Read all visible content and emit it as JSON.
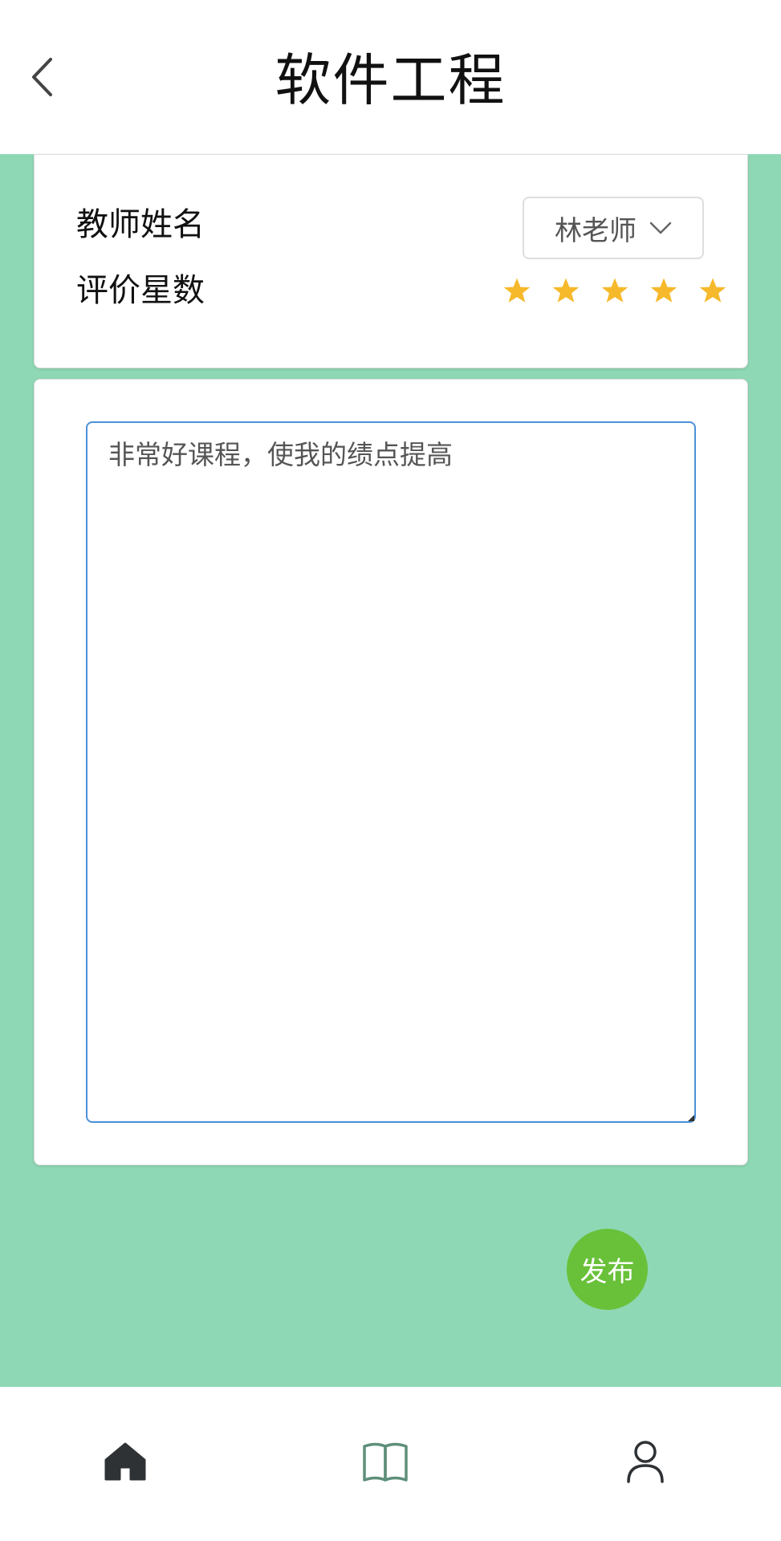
{
  "header": {
    "title": "软件工程",
    "back_icon": "chevron-left-icon"
  },
  "info_card": {
    "teacher_label": "教师姓名",
    "teacher_selected": "林老师",
    "rating_label": "评价星数",
    "rating_value": 5,
    "rating_max": 5,
    "star_color": "#f6b92b"
  },
  "comment": {
    "text": "非常好课程，使我的绩点提高",
    "border_color": "#4a90d9"
  },
  "publish": {
    "label": "发布",
    "color": "#69c13a"
  },
  "nav": {
    "items": [
      {
        "icon": "home-icon"
      },
      {
        "icon": "book-icon"
      },
      {
        "icon": "user-icon"
      }
    ]
  },
  "colors": {
    "background": "#8fd8b5"
  }
}
